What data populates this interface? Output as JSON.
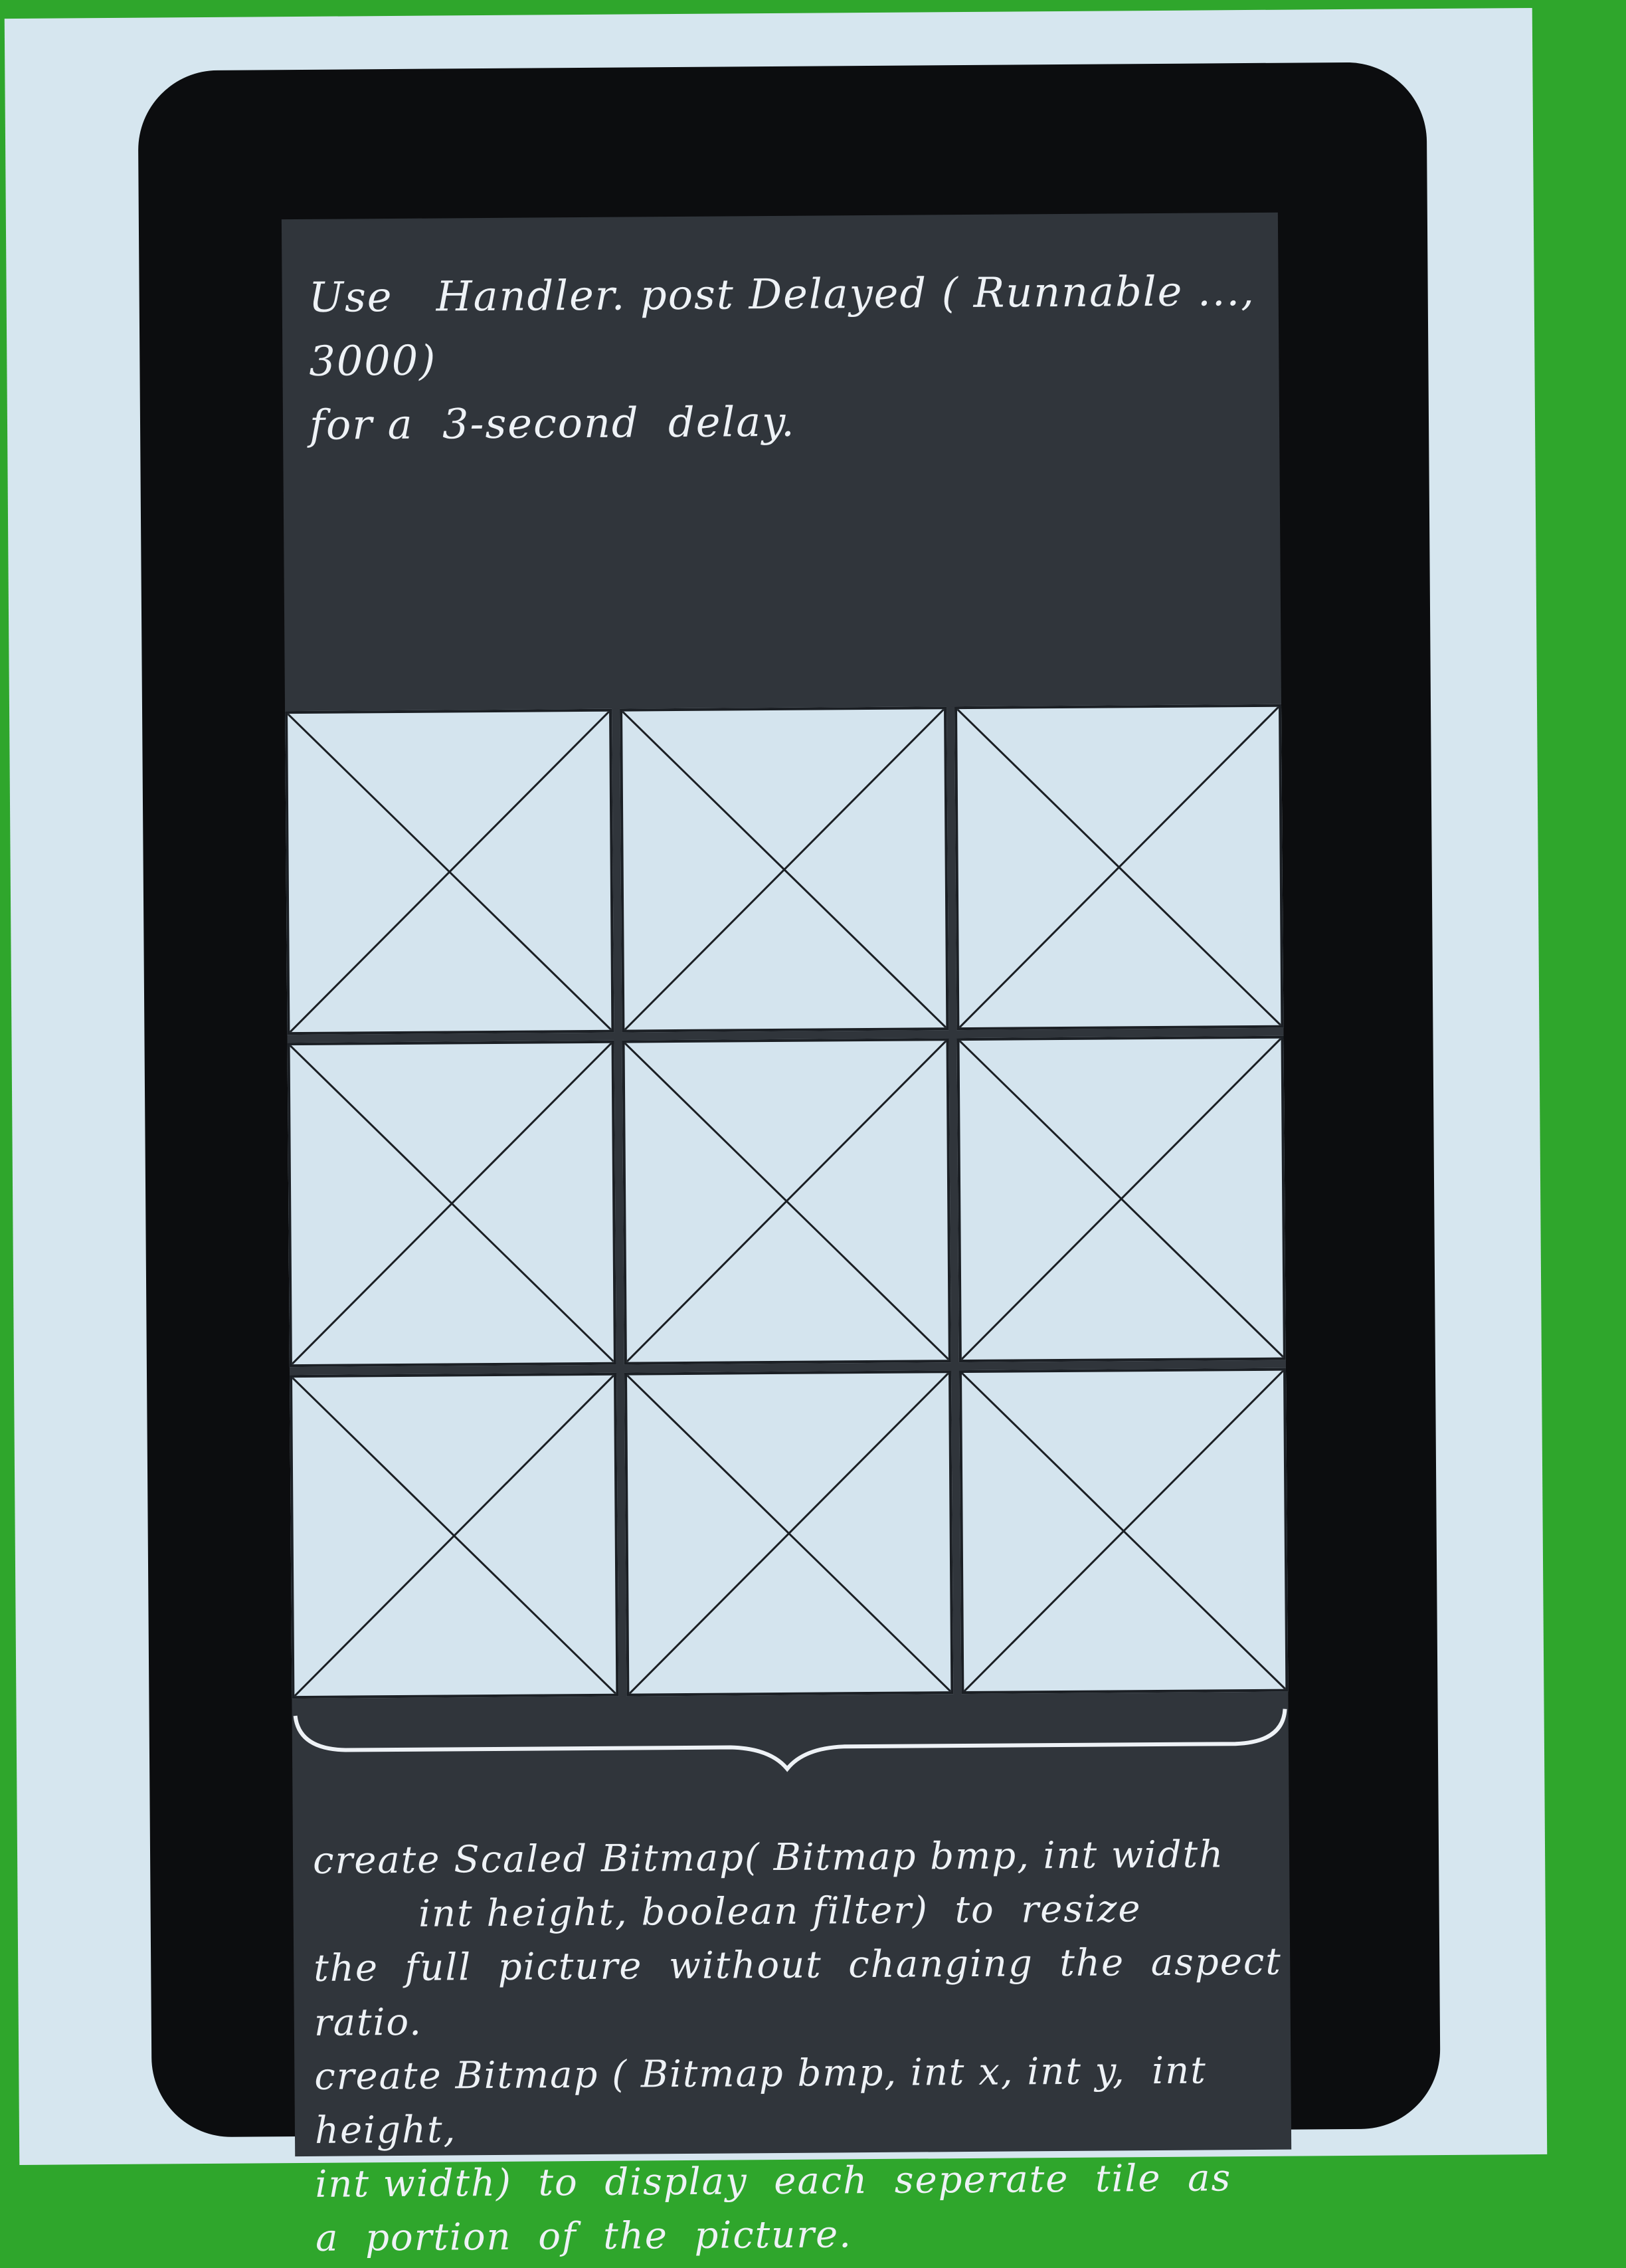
{
  "sketch": {
    "top_note": "Use   Handler. post Delayed ( Runnable ..., 3000)\nfor a  3-second  delay.",
    "bottom_note": "create Scaled Bitmap( Bitmap bmp, int width\n        int height, boolean filter)  to  resize\nthe  full  picture  without  changing  the  aspect\nratio.\ncreate Bitmap ( Bitmap bmp, int x, int y,  int height,\nint width)  to  display  each  seperate  tile  as\na  portion  of  the  picture."
  },
  "grid": {
    "rows": 3,
    "columns": 3,
    "tile_icon": "image-placeholder-x-icon"
  },
  "colors": {
    "background": "#2fa62c",
    "paper": "#d6e6ef",
    "device": "#0c0d0f",
    "screen": "#30353b",
    "tile": "#d4e4ee",
    "ink": "#1b1f24",
    "chalk": "#eef2f6"
  }
}
